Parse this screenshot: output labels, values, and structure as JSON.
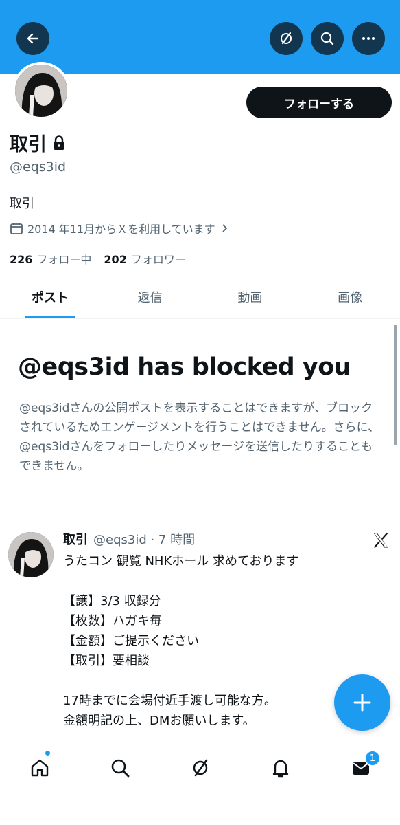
{
  "profile": {
    "name": "取引",
    "handle": "@eqs3id",
    "bio": "取引",
    "joined": "2014 年11月からＸを利用しています",
    "following_count": "226",
    "following_label": "フォロー中",
    "followers_count": "202",
    "followers_label": "フォロワー",
    "follow_button": "フォローする"
  },
  "tabs": [
    "ポスト",
    "返信",
    "動画",
    "画像"
  ],
  "blocked": {
    "title": "@eqs3id has blocked you",
    "message": "@eqs3idさんの公開ポストを表示することはできますが、ブロックされているためエンゲージメントを行うことはできません。さらに、@eqs3idさんをフォローしたりメッセージを送信したりすることもできません。"
  },
  "post": {
    "name": "取引",
    "meta": "@eqs3id · 7 時間",
    "body": "うたコン 観覧 NHKホール 求めております\n\n【譲】3/3 収録分\n【枚数】ハガキ毎\n【金額】ご提示ください\n【取引】要相談\n\n17時までに会場付近手渡し可能な方。\n金額明記の上、DMお願いします。"
  },
  "nav": {
    "messages_badge": "1",
    "icons": [
      "home-icon",
      "search-icon",
      "grok-icon",
      "bell-icon",
      "mail-icon"
    ]
  },
  "colors": {
    "accent": "#1d9bf0",
    "banner": "#1d9bf0",
    "text_primary": "#0f1419",
    "text_secondary": "#536471"
  }
}
